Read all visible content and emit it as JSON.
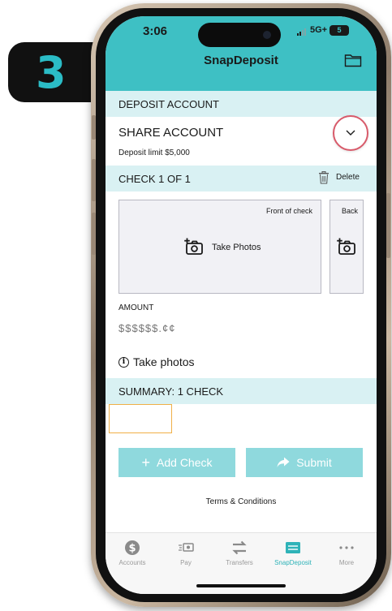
{
  "step": {
    "number": "3"
  },
  "status_bar": {
    "time": "3:06",
    "network": "5G+",
    "battery": "5"
  },
  "header": {
    "title": "SnapDeposit"
  },
  "deposit_account": {
    "section_label": "DEPOSIT ACCOUNT",
    "account_name": "SHARE ACCOUNT",
    "limit_text": "Deposit limit $5,000"
  },
  "check": {
    "section_label": "CHECK 1 OF 1",
    "delete_label": "Delete",
    "front_label": "Front of check",
    "back_label": "Back",
    "take_photos_label": "Take Photos"
  },
  "amount": {
    "label": "AMOUNT",
    "placeholder": "$$$$$$.¢¢"
  },
  "notice": {
    "text": "Take photos"
  },
  "summary": {
    "section_label": "SUMMARY: 1 CHECK"
  },
  "actions": {
    "add_check": "Add Check",
    "submit": "Submit"
  },
  "terms": "Terms & Conditions",
  "tabs": [
    {
      "label": "Accounts",
      "icon": "dollar-circle-icon"
    },
    {
      "label": "Pay",
      "icon": "pay-icon"
    },
    {
      "label": "Transfers",
      "icon": "transfer-arrows-icon"
    },
    {
      "label": "SnapDeposit",
      "icon": "snapdeposit-icon"
    },
    {
      "label": "More",
      "icon": "more-dots-icon"
    }
  ],
  "colors": {
    "accent": "#3ec0c4",
    "band": "#d9f1f3",
    "button": "#8fd9dd",
    "badge_text": "#2bbcc6",
    "dropdown_ring": "#d85a6a"
  }
}
